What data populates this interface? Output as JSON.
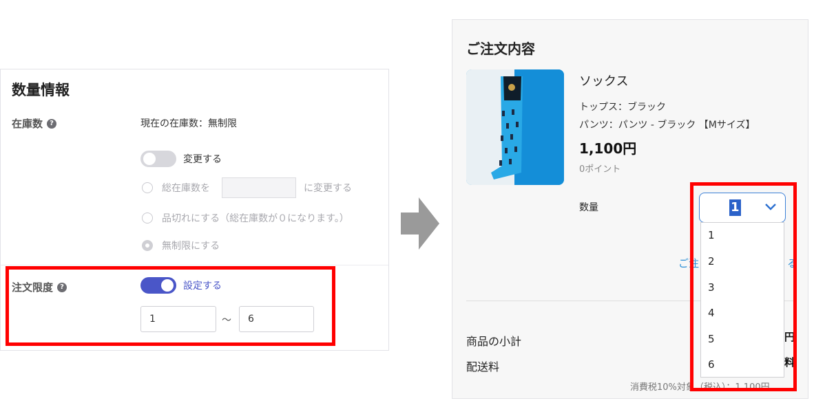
{
  "quantity_panel": {
    "title": "数量情報",
    "stock_label": "在庫数",
    "stock_current": "現在の在庫数：無制限",
    "change_toggle_label": "変更する",
    "change_toggle_on": false,
    "set_total_prefix": "総在庫数を",
    "set_total_suffix": "に変更する",
    "set_total_value": "",
    "sold_out_label": "品切れにする（総在庫数が０になります。）",
    "unlimited_label": "無制限にする",
    "order_limit_label": "注文限度",
    "order_limit_toggle_label": "設定する",
    "order_limit_toggle_on": true,
    "order_min": "1",
    "range_sep": "〜",
    "order_max": "6"
  },
  "order_panel": {
    "title": "ご注文内容",
    "product_name": "ソックス",
    "variant_1": "トップス：ブラック",
    "variant_2": "パンツ：パンツ - ブラック 【Mサイズ】",
    "price": "1,100円",
    "points": "0ポイント",
    "quantity_label": "数量",
    "quantity_selected": "1",
    "quantity_options": [
      "1",
      "2",
      "3",
      "4",
      "5",
      "6"
    ],
    "partial_link_left": "ご注",
    "partial_link_right": "る",
    "subtotal_label": "商品の小計",
    "subtotal_partial": "円",
    "shipping_label": "配送料",
    "shipping_partial": "料",
    "tax_note": "消費税10%対象（税込）：1,100円"
  },
  "colors": {
    "accent": "#4a56c8",
    "highlight": "#ff0000",
    "link": "#2b8fd6"
  },
  "icons": [
    "help-icon",
    "chevron-down-icon",
    "arrow-right-icon"
  ]
}
